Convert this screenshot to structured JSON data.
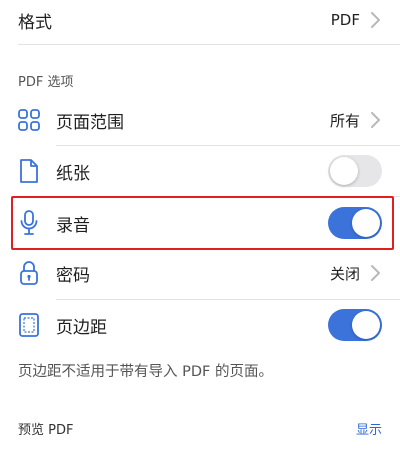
{
  "format": {
    "label": "格式",
    "value": "PDF"
  },
  "pdf_options_header": "PDF 选项",
  "options": {
    "page_range": {
      "label": "页面范围",
      "value": "所有"
    },
    "paper": {
      "label": "纸张",
      "toggle_on": false
    },
    "recording": {
      "label": "录音",
      "toggle_on": true
    },
    "password": {
      "label": "密码",
      "value": "关闭"
    },
    "margins": {
      "label": "页边距",
      "toggle_on": true
    }
  },
  "margins_note": "页边距不适用于带有导入 PDF 的页面。",
  "preview": {
    "label": "预览 PDF",
    "action": "显示"
  },
  "colors": {
    "accent": "#3b73db",
    "highlight": "#e02020",
    "link": "#2e66d6"
  }
}
